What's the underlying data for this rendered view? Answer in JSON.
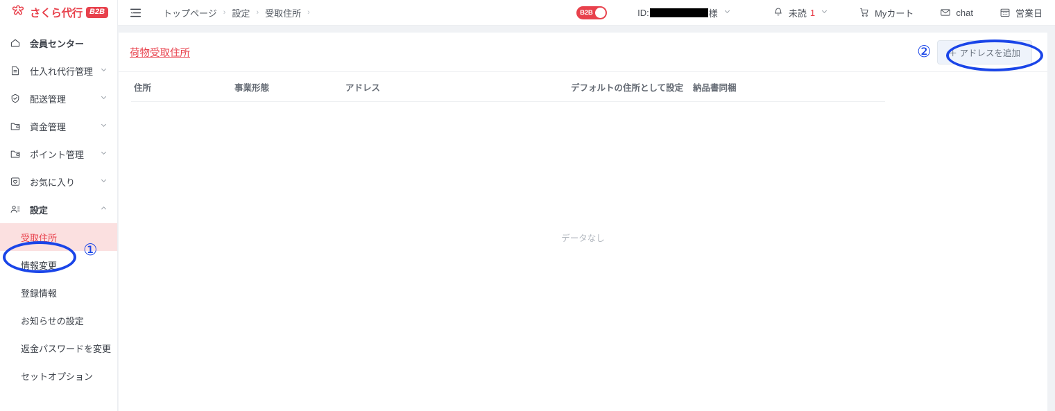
{
  "brand": {
    "name": "さくら代行",
    "badge": "B2B",
    "logo_icon": "sakura-blossom-icon",
    "accent_color": "#e8414c"
  },
  "header": {
    "menu_icon": "hamburger-menu-icon",
    "breadcrumb": [
      "トップページ",
      "設定",
      "受取住所"
    ],
    "breadcrumb_separator": "›",
    "b2b_toggle": {
      "label": "B2B",
      "state": "on",
      "color": "#e8414c"
    },
    "account": {
      "id_label": "ID:",
      "id_value_redacted": true,
      "honorific": "様",
      "caret_icon": "chevron-down-icon"
    },
    "notifications": {
      "bell_icon": "bell-icon",
      "label": "未読",
      "count": "1",
      "count_color": "#e8414c",
      "caret_icon": "chevron-down-icon"
    },
    "actions": [
      {
        "label": "Myカート",
        "icon": "cart-icon"
      },
      {
        "label": "chat",
        "icon": "mail-icon"
      },
      {
        "label": "営業日",
        "icon": "calendar-icon"
      }
    ]
  },
  "sidebar": {
    "items": [
      {
        "label": "会員センター",
        "icon": "home-icon",
        "bold": true,
        "chevron": ""
      },
      {
        "label": "仕入れ代行管理",
        "icon": "document-icon",
        "bold": false,
        "chevron": "down"
      },
      {
        "label": "配送管理",
        "icon": "shipping-badge-icon",
        "bold": false,
        "chevron": "down"
      },
      {
        "label": "資金管理",
        "icon": "wallet-folder-icon",
        "bold": false,
        "chevron": "down"
      },
      {
        "label": "ポイント管理",
        "icon": "wallet-folder-icon",
        "bold": false,
        "chevron": "down"
      },
      {
        "label": "お気に入り",
        "icon": "favorite-box-icon",
        "bold": false,
        "chevron": "down"
      },
      {
        "label": "設定",
        "icon": "user-settings-icon",
        "bold": true,
        "chevron": "up"
      }
    ],
    "sub_items": [
      {
        "label": "受取住所",
        "active": true
      },
      {
        "label": "情報変更",
        "active": false
      },
      {
        "label": "登録情報",
        "active": false
      },
      {
        "label": "お知らせの設定",
        "active": false
      },
      {
        "label": "返金パスワードを変更",
        "active": false
      },
      {
        "label": "セットオプション",
        "active": false
      }
    ]
  },
  "main": {
    "title": "荷物受取住所",
    "add_button_label": "＋ アドレスを追加",
    "table": {
      "columns": [
        "住所",
        "事業形態",
        "アドレス",
        "デフォルトの住所として設定",
        "納品書同梱"
      ],
      "rows": [],
      "empty_text": "データなし"
    }
  },
  "annotations": [
    {
      "number": "①",
      "target": "sidebar-subitem-受取住所",
      "color": "#1a45e8"
    },
    {
      "number": "②",
      "target": "add-address-button",
      "color": "#1a45e8"
    }
  ]
}
